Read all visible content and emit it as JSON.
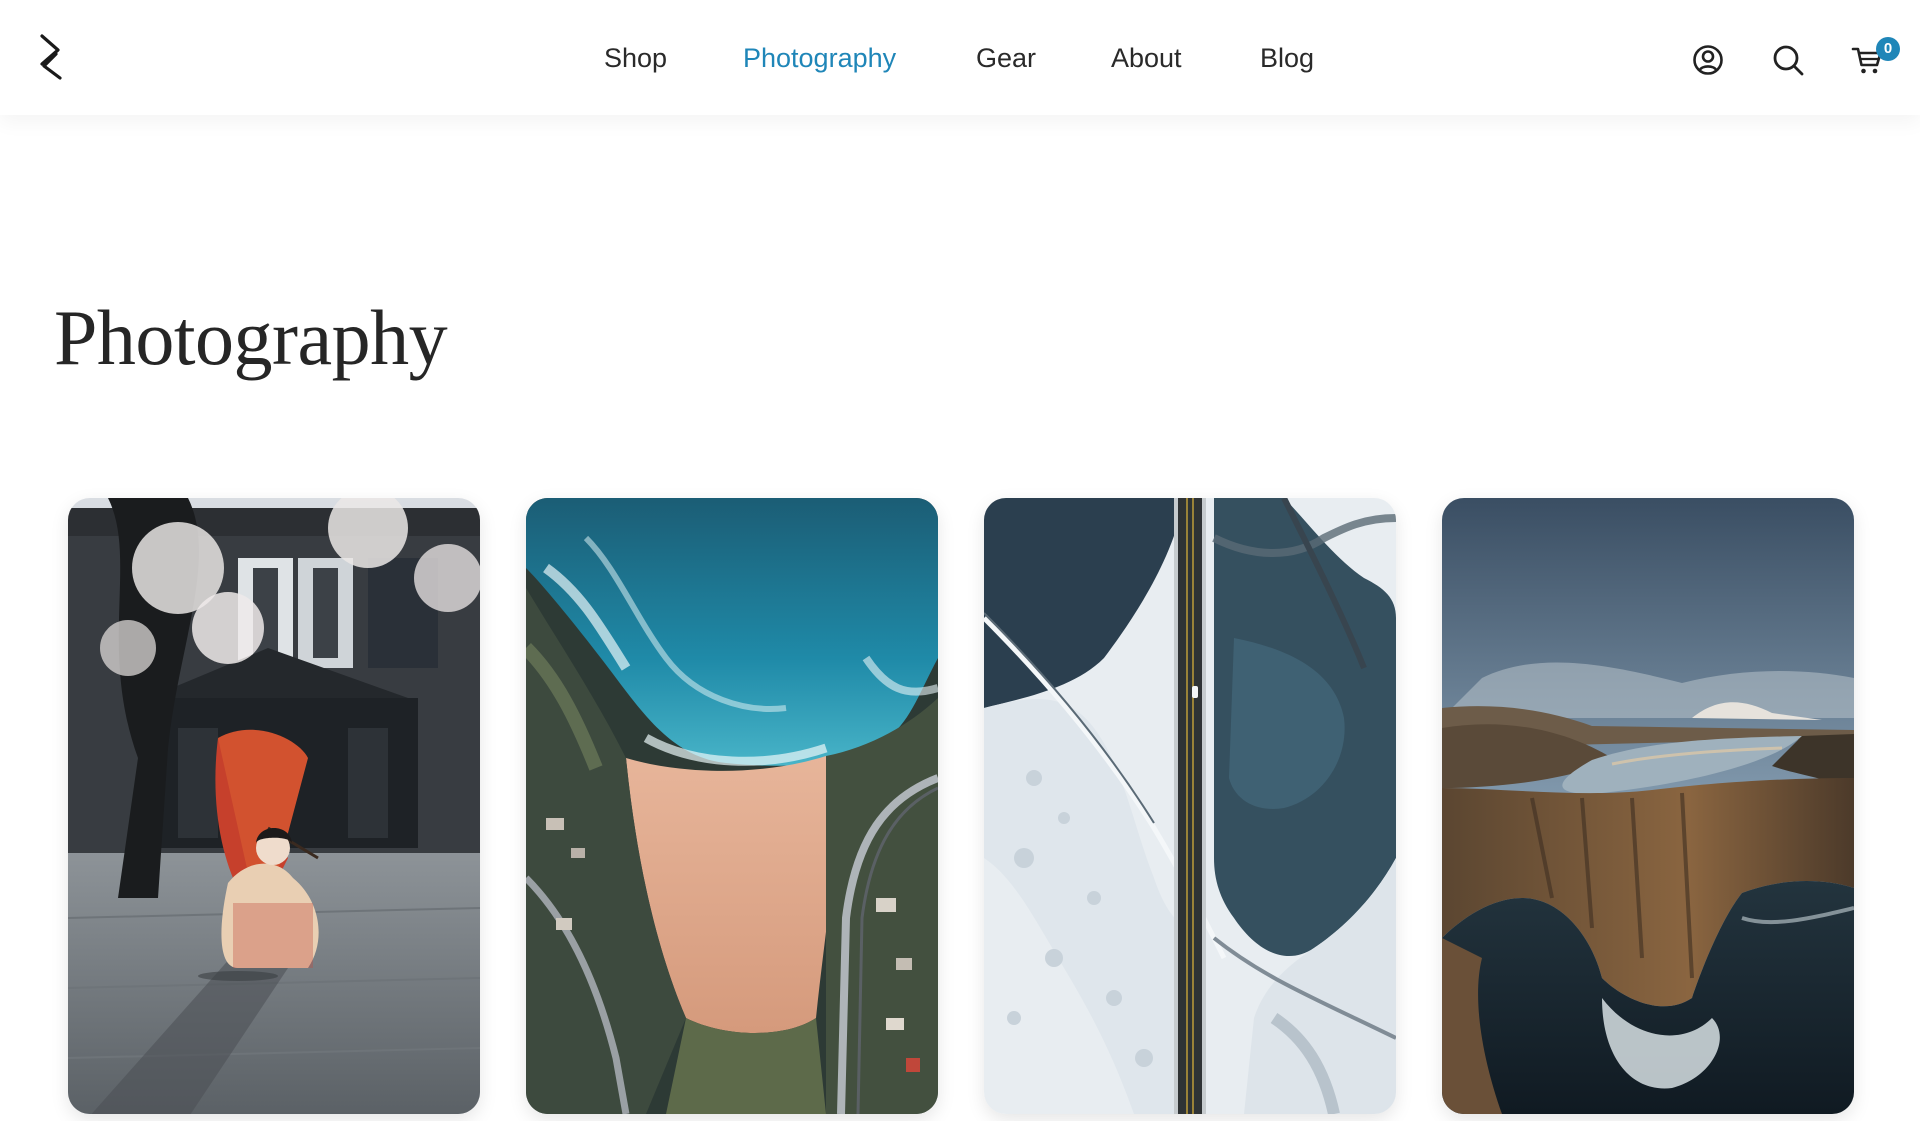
{
  "header": {
    "logo_icon": "brand-logo-icon",
    "nav": [
      {
        "label": "Shop",
        "active": false
      },
      {
        "label": "Photography",
        "active": true
      },
      {
        "label": "Gear",
        "active": false
      },
      {
        "label": "About",
        "active": false
      },
      {
        "label": "Blog",
        "active": false
      }
    ],
    "icons": [
      "account-icon",
      "search-icon",
      "cart-icon"
    ],
    "cart_count": "0"
  },
  "page": {
    "title": "Photography"
  },
  "gallery": {
    "photos": [
      {
        "subject": "kimono-woman-red-umbrella-temple"
      },
      {
        "subject": "aerial-beach-coastline-road"
      },
      {
        "subject": "aerial-snowy-road-river"
      },
      {
        "subject": "sea-cliff-lake-sunset"
      }
    ]
  },
  "colors": {
    "accent": "#1f86b8",
    "text": "#2a2a2a",
    "background": "#ffffff"
  }
}
